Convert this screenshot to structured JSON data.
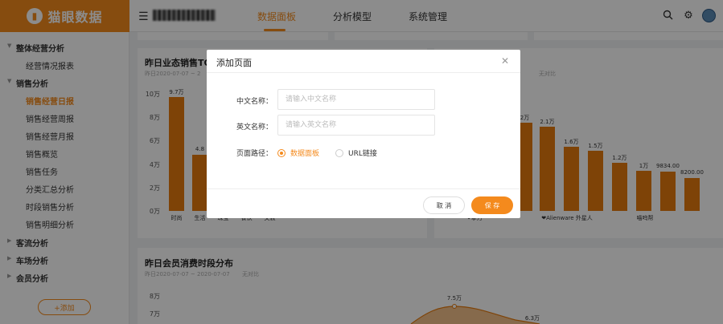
{
  "header": {
    "logo_text": "猫眼数据",
    "tabs": [
      {
        "label": "数据面板"
      },
      {
        "label": "分析模型"
      },
      {
        "label": "系统管理"
      }
    ]
  },
  "sidebar": {
    "items": [
      {
        "label": "整体经营分析"
      },
      {
        "label": "经营情况报表"
      },
      {
        "label": "销售分析"
      },
      {
        "label": "销售经营日报"
      },
      {
        "label": "销售经营周报"
      },
      {
        "label": "销售经营月报"
      },
      {
        "label": "销售概览"
      },
      {
        "label": "销售任务"
      },
      {
        "label": "分类汇总分析"
      },
      {
        "label": "时段销售分析"
      },
      {
        "label": "销售明细分析"
      },
      {
        "label": "客流分析"
      },
      {
        "label": "车场分析"
      },
      {
        "label": "会员分析"
      }
    ],
    "add_label": "+添加"
  },
  "panels": {
    "left_title": "昨日业态销售TO",
    "left_date": "昨日2020-07-07 ~ 2",
    "right_compare": "无对比",
    "bottom_title": "昨日会员消费时段分布",
    "bottom_date": "昨日2020-07-07 ~ 2020-07-07",
    "bottom_compare": "无对比"
  },
  "chart_data": [
    {
      "type": "bar",
      "yticks": [
        "10万",
        "8万",
        "6万",
        "4万",
        "2万",
        "0万"
      ],
      "ylim": [
        0,
        10
      ],
      "values": [
        9.7,
        4.8
      ],
      "labels": [
        "9.7万",
        "4.8"
      ],
      "categories": [
        "时尚",
        "生活",
        "珠宝",
        "餐饮",
        "文教"
      ]
    },
    {
      "type": "bar",
      "values": [
        2.2,
        2.1,
        1.6,
        1.5,
        1.2,
        1.0,
        0.9834,
        0.82
      ],
      "labels": [
        "2万",
        "2.1万",
        "1.6万",
        "1.5万",
        "1.2万",
        "1万",
        "9834.00",
        "8200.00"
      ],
      "categories": [
        "❤拿万",
        "❤Alienware 外星人",
        "喵呜帮"
      ]
    },
    {
      "type": "area",
      "yticks": [
        "8万",
        "7万"
      ],
      "labels": [
        "7.5万",
        "6.3万"
      ]
    }
  ],
  "modal": {
    "title": "添加页面",
    "cn_label": "中文名称：",
    "cn_placeholder": "请输入中文名称",
    "en_label": "英文名称：",
    "en_placeholder": "请输入英文名称",
    "path_label": "页面路径：",
    "radio_options": [
      {
        "label": "数据面板",
        "checked": true
      },
      {
        "label": "URL链接",
        "checked": false
      }
    ],
    "cancel_label": "取 消",
    "save_label": "保 存"
  },
  "colors": {
    "accent": "#f48a1d",
    "bar": "#e67a0d"
  }
}
